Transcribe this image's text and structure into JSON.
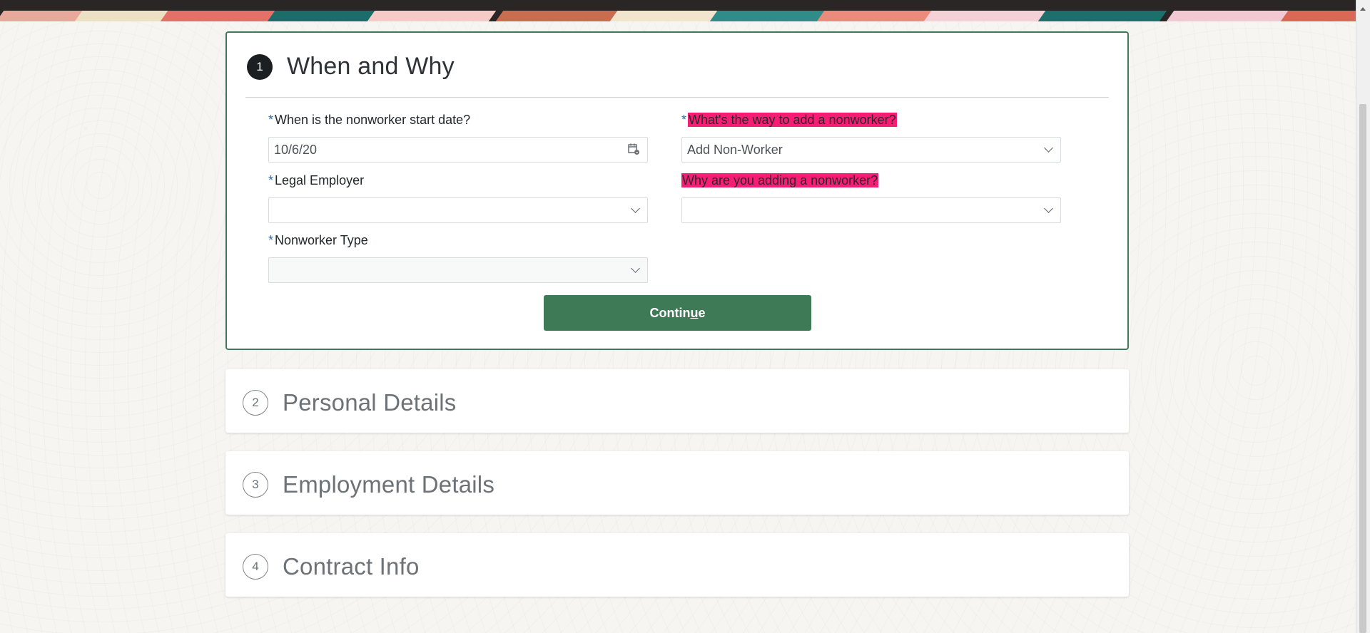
{
  "sections": [
    {
      "number": "1",
      "title": "When and Why",
      "fields": {
        "start_date": {
          "label": "When is the nonworker start date?",
          "value": "10/6/20"
        },
        "add_way": {
          "label": "What's the way to add a nonworker?",
          "value": "Add Non-Worker"
        },
        "legal_employer": {
          "label": "Legal Employer",
          "value": ""
        },
        "reason": {
          "label": "Why are you adding a nonworker?",
          "value": ""
        },
        "nonworker_type": {
          "label": "Nonworker Type",
          "value": ""
        }
      },
      "continue_button": {
        "before": "Contin",
        "underlined": "u",
        "after": "e"
      }
    },
    {
      "number": "2",
      "title": "Personal Details"
    },
    {
      "number": "3",
      "title": "Employment Details"
    },
    {
      "number": "4",
      "title": "Contract Info"
    }
  ],
  "required_marker": "*",
  "icons": {
    "calendar": "calendar-icon",
    "dropdown": "chevron-down-icon",
    "scroll_up": "scroll-up-icon"
  },
  "colors": {
    "accent_green": "#3f7a57",
    "highlight_pink": "#f51d74",
    "required_blue": "#2d6da3"
  }
}
